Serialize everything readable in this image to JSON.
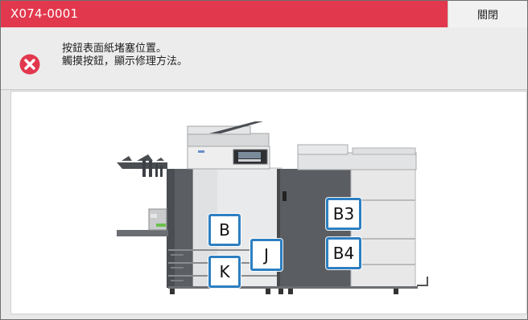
{
  "titlebar": {
    "code": "X074-0001",
    "close_label": "關閉"
  },
  "message": {
    "icon": "error-x-icon",
    "line1": "按鈕表面紙堵塞位置。",
    "line2": "觸摸按鈕，顯示修理方法。"
  },
  "jam_zones": {
    "b": "B",
    "j": "J",
    "k": "K",
    "b3": "B3",
    "b4": "B4"
  },
  "colors": {
    "titlebar": "#e2384d",
    "zone_border": "#2d7fc1",
    "error_icon": "#e2384d"
  }
}
